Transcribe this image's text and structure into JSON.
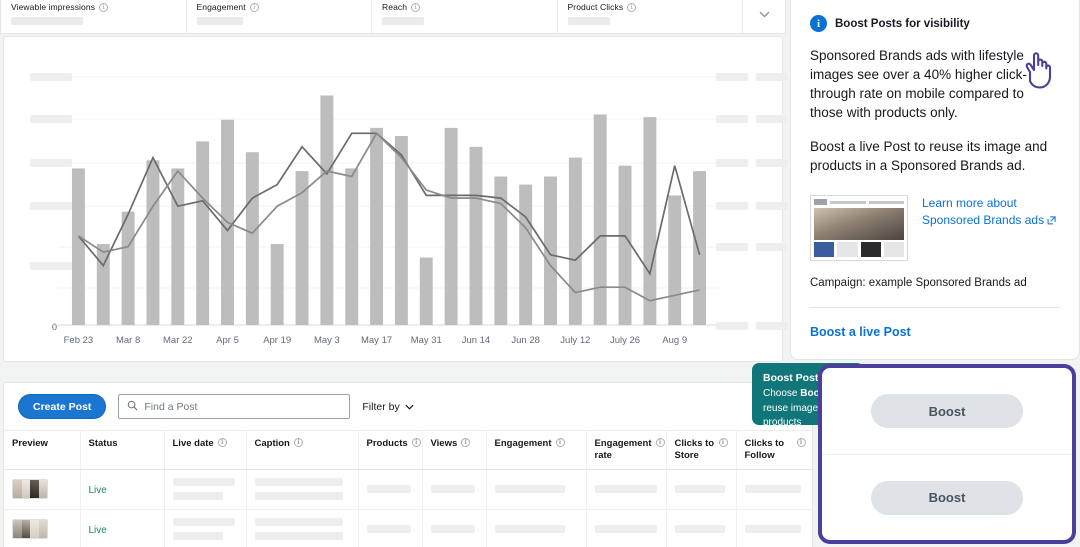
{
  "metrics": {
    "chevron_icon": "chevron-down-icon",
    "items": [
      {
        "label": "Viewable impressions",
        "value": ""
      },
      {
        "label": "Engagement",
        "value": ""
      },
      {
        "label": "Reach",
        "value": ""
      },
      {
        "label": "Product Clicks",
        "value": ""
      }
    ]
  },
  "chart_data": {
    "type": "bar",
    "title": "",
    "xlabel": "",
    "ylabel": "",
    "grid": true,
    "legend": "none",
    "y_zero_label": "0",
    "ylim": [
      0,
      100
    ],
    "y_tick_labels_hidden": true,
    "categories": [
      "Feb 23",
      "",
      "Mar 8",
      "",
      "Mar 22",
      "",
      "Apr 5",
      "",
      "Apr 19",
      "",
      "May 3",
      "",
      "May 17",
      "",
      "May 31",
      "",
      "Jun 14",
      "",
      "Jun 28",
      "",
      "July 12",
      "",
      "July 26",
      "",
      "Aug 9",
      ""
    ],
    "tick_labels": [
      "Feb 23",
      "Mar 8",
      "Mar 22",
      "Apr 5",
      "Apr 19",
      "May 3",
      "May 17",
      "May 31",
      "Jun 14",
      "Jun 28",
      "July 12",
      "July 26",
      "Aug 9"
    ],
    "series": [
      {
        "name": "bars",
        "type": "bar",
        "color": "#bdbdbd",
        "values": [
          58,
          30,
          42,
          61,
          58,
          68,
          76,
          64,
          30,
          57,
          85,
          58,
          73,
          70,
          25,
          73,
          66,
          55,
          52,
          55,
          62,
          78,
          59,
          77,
          48,
          57
        ]
      },
      {
        "name": "line-1",
        "type": "line",
        "color": "#6b6b6b",
        "values": [
          33,
          22,
          41,
          62,
          44,
          46,
          35,
          47,
          52,
          66,
          56,
          71,
          71,
          63,
          48,
          48,
          48,
          47,
          40,
          26,
          24,
          33,
          33,
          19,
          59,
          26
        ]
      },
      {
        "name": "line-2",
        "type": "line",
        "color": "#8a8a8a",
        "values": [
          33,
          27,
          29,
          44,
          57,
          47,
          38,
          34,
          44,
          49,
          57,
          55,
          71,
          62,
          50,
          47,
          47,
          45,
          36,
          22,
          12,
          14,
          14,
          9,
          11,
          13
        ]
      }
    ]
  },
  "posts": {
    "create_button": "Create Post",
    "search_placeholder": "Find a Post",
    "search_value": "",
    "search_icon": "search-icon",
    "filter_label": "Filter by",
    "filter_icon": "chevron-down-icon",
    "columns": [
      {
        "label": "Preview",
        "info": false
      },
      {
        "label": "Status",
        "info": false
      },
      {
        "label": "Live date",
        "info": true
      },
      {
        "label": "Caption",
        "info": true
      },
      {
        "label": "Products",
        "info": true
      },
      {
        "label": "Views",
        "info": true
      },
      {
        "label": "Engagement",
        "info": true
      },
      {
        "label": "Engagement rate",
        "info": true
      },
      {
        "label": "Clicks to Store",
        "info": true
      },
      {
        "label": "Clicks to Follow",
        "info": true
      }
    ],
    "rows": [
      {
        "status": "Live"
      },
      {
        "status": "Live"
      }
    ]
  },
  "sidebar": {
    "info_icon": "info-icon",
    "title": "Boost Posts for visibility",
    "paragraph_1": "Sponsored Brands ads with lifestyle images see over a 40% higher click-through rate on mobile compared to those with products only.",
    "paragraph_2": "Boost a live Post to reuse its image and products in a Sponsored Brands ad.",
    "learn_more_line_1": "Learn more about",
    "learn_more_line_2": "Sponsored Brands ads",
    "external_link_icon": "external-link-icon",
    "caption": "Campaign: example Sponsored Brands ad",
    "boost_link": "Boost a live Post"
  },
  "tooltip": {
    "title": "Boost Posts",
    "body_prefix": "Choose ",
    "body_bold": "Boost",
    "body_suffix": " to reuse image and products"
  },
  "overlay": {
    "boost_button_1": "Boost",
    "boost_button_2": "Boost",
    "cursor_icon": "hand-cursor-icon",
    "border_color": "#4b3f9e"
  },
  "colors": {
    "accent_blue": "#0972d3",
    "create_button": "#1b76d2",
    "status_green": "#1f8a5f",
    "teal_tooltip": "#11767a",
    "highlight_purple": "#4b3f9e",
    "bar_grey": "#bdbdbd"
  }
}
